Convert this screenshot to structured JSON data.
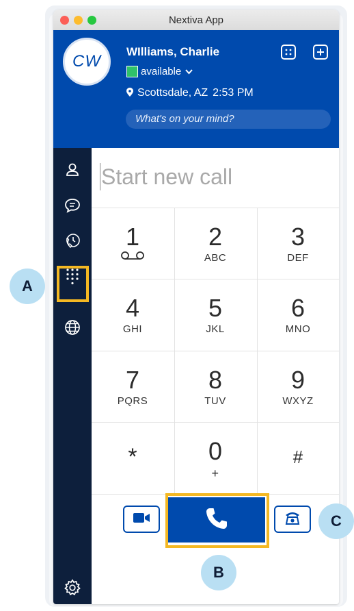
{
  "window": {
    "title": "Nextiva App"
  },
  "profile": {
    "initials": "CW",
    "name": "WIlliams, Charlie",
    "status": "available",
    "location": "Scottsdale, AZ",
    "time": "2:53 PM",
    "mood_placeholder": "What's on your mind?"
  },
  "header_icons": [
    "contact-card-icon",
    "add-icon"
  ],
  "sidebar": {
    "items": [
      {
        "name": "contacts",
        "icon": "person-icon"
      },
      {
        "name": "messages",
        "icon": "chat-bubble-icon"
      },
      {
        "name": "call-history",
        "icon": "phone-history-icon"
      },
      {
        "name": "dialpad",
        "icon": "dialpad-icon",
        "active": true
      },
      {
        "name": "web",
        "icon": "globe-icon"
      }
    ],
    "settings_icon": "gear-icon"
  },
  "dialer": {
    "placeholder": "Start new call",
    "keys": [
      {
        "digit": "1",
        "letters": "",
        "voicemail": true
      },
      {
        "digit": "2",
        "letters": "ABC"
      },
      {
        "digit": "3",
        "letters": "DEF"
      },
      {
        "digit": "4",
        "letters": "GHI"
      },
      {
        "digit": "5",
        "letters": "JKL"
      },
      {
        "digit": "6",
        "letters": "MNO"
      },
      {
        "digit": "7",
        "letters": "PQRS"
      },
      {
        "digit": "8",
        "letters": "TUV"
      },
      {
        "digit": "9",
        "letters": "WXYZ"
      },
      {
        "digit": "*",
        "letters": ""
      },
      {
        "digit": "0",
        "letters": "+"
      },
      {
        "digit": "#",
        "letters": ""
      }
    ]
  },
  "actions": {
    "video_icon": "video-camera-icon",
    "call_icon": "phone-icon",
    "deskphone_icon": "desk-phone-icon"
  },
  "annotations": {
    "a": "A",
    "b": "B",
    "c": "C"
  },
  "colors": {
    "brand_blue": "#004aad",
    "sidebar": "#0d1f3c",
    "status_green": "#2fc26a",
    "highlight": "#f4b823",
    "marker": "#b9dff3"
  }
}
